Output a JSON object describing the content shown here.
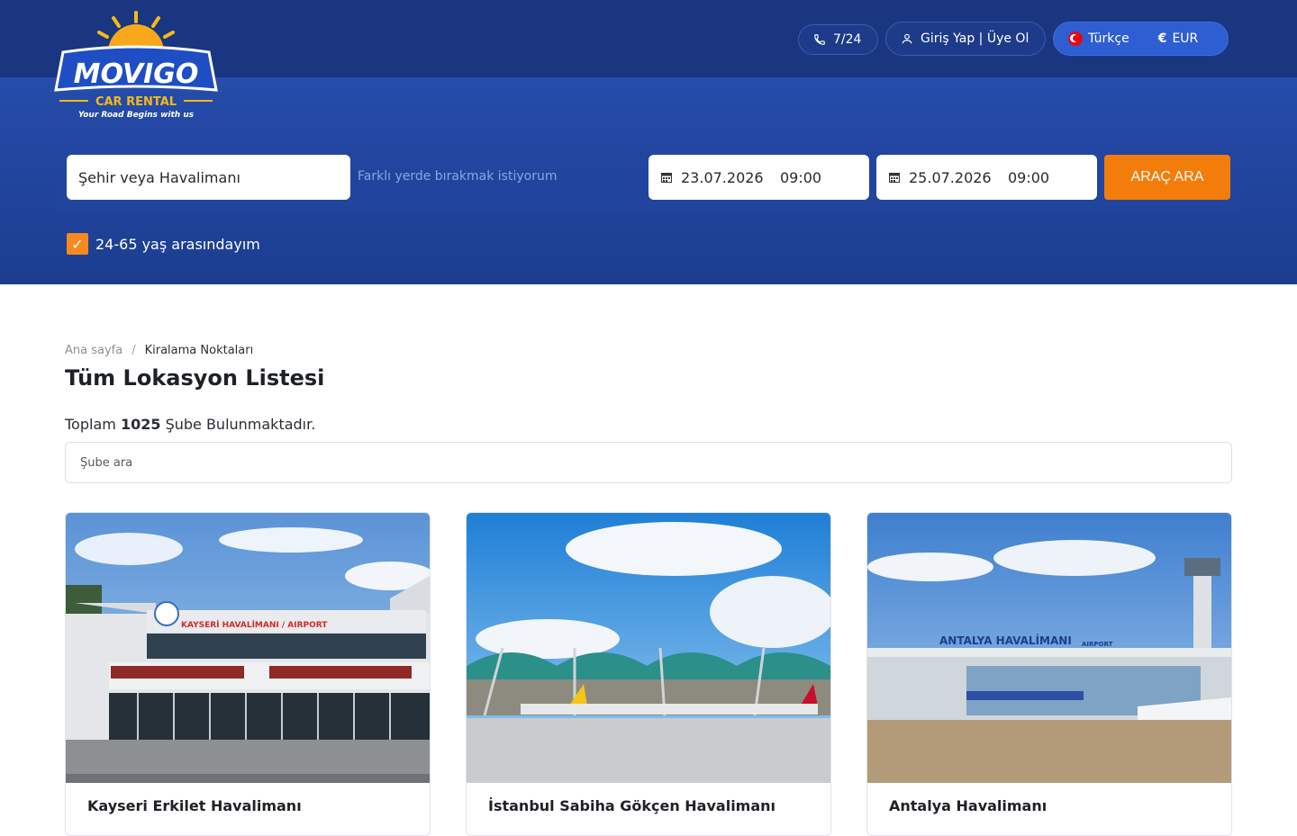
{
  "brand": {
    "logo_text": "MOVIGO",
    "logo_sub": "CAR RENTAL",
    "tagline": "Your Road Begins with us"
  },
  "topbar": {
    "phone_label": "7/24",
    "login_label": "Giriş Yap | Üye Ol",
    "language_label": "Türkçe",
    "currency_symbol": "€",
    "currency_label": "EUR"
  },
  "search": {
    "location_placeholder": "Şehir veya Havalimanı",
    "return_elsewhere_label": "Farklı yerde bırakmak istiyorum",
    "pickup_date": "23.07.2026",
    "pickup_time": "09:00",
    "return_date": "25.07.2026",
    "return_time": "09:00",
    "submit_label": "ARAÇ ARA",
    "age_label": "24-65 yaş arasındayım",
    "age_checked": true
  },
  "breadcrumb": {
    "home": "Ana sayfa",
    "separator": "/",
    "current": "Kiralama Noktaları"
  },
  "page": {
    "title": "Tüm Lokasyon Listesi",
    "total_prefix": "Toplam",
    "total_count": "1025",
    "total_suffix": "Şube Bulunmaktadır.",
    "branch_search_placeholder": "Şube ara"
  },
  "locations": [
    {
      "name": "Kayseri Erkilet Havalimanı",
      "sign": "KAYSERİ HAVALİMANI / AIRPORT"
    },
    {
      "name": "İstanbul Sabiha Gökçen Havalimanı"
    },
    {
      "name": "Antalya Havalimanı",
      "sign": "ANTALYA HAVALİMANI",
      "sign_sub": "AIRPORT"
    }
  ],
  "colors": {
    "hero": "#2449a6",
    "topbar": "#1a3680",
    "accent": "#f37d0b",
    "logo_yellow": "#f6b91a"
  }
}
